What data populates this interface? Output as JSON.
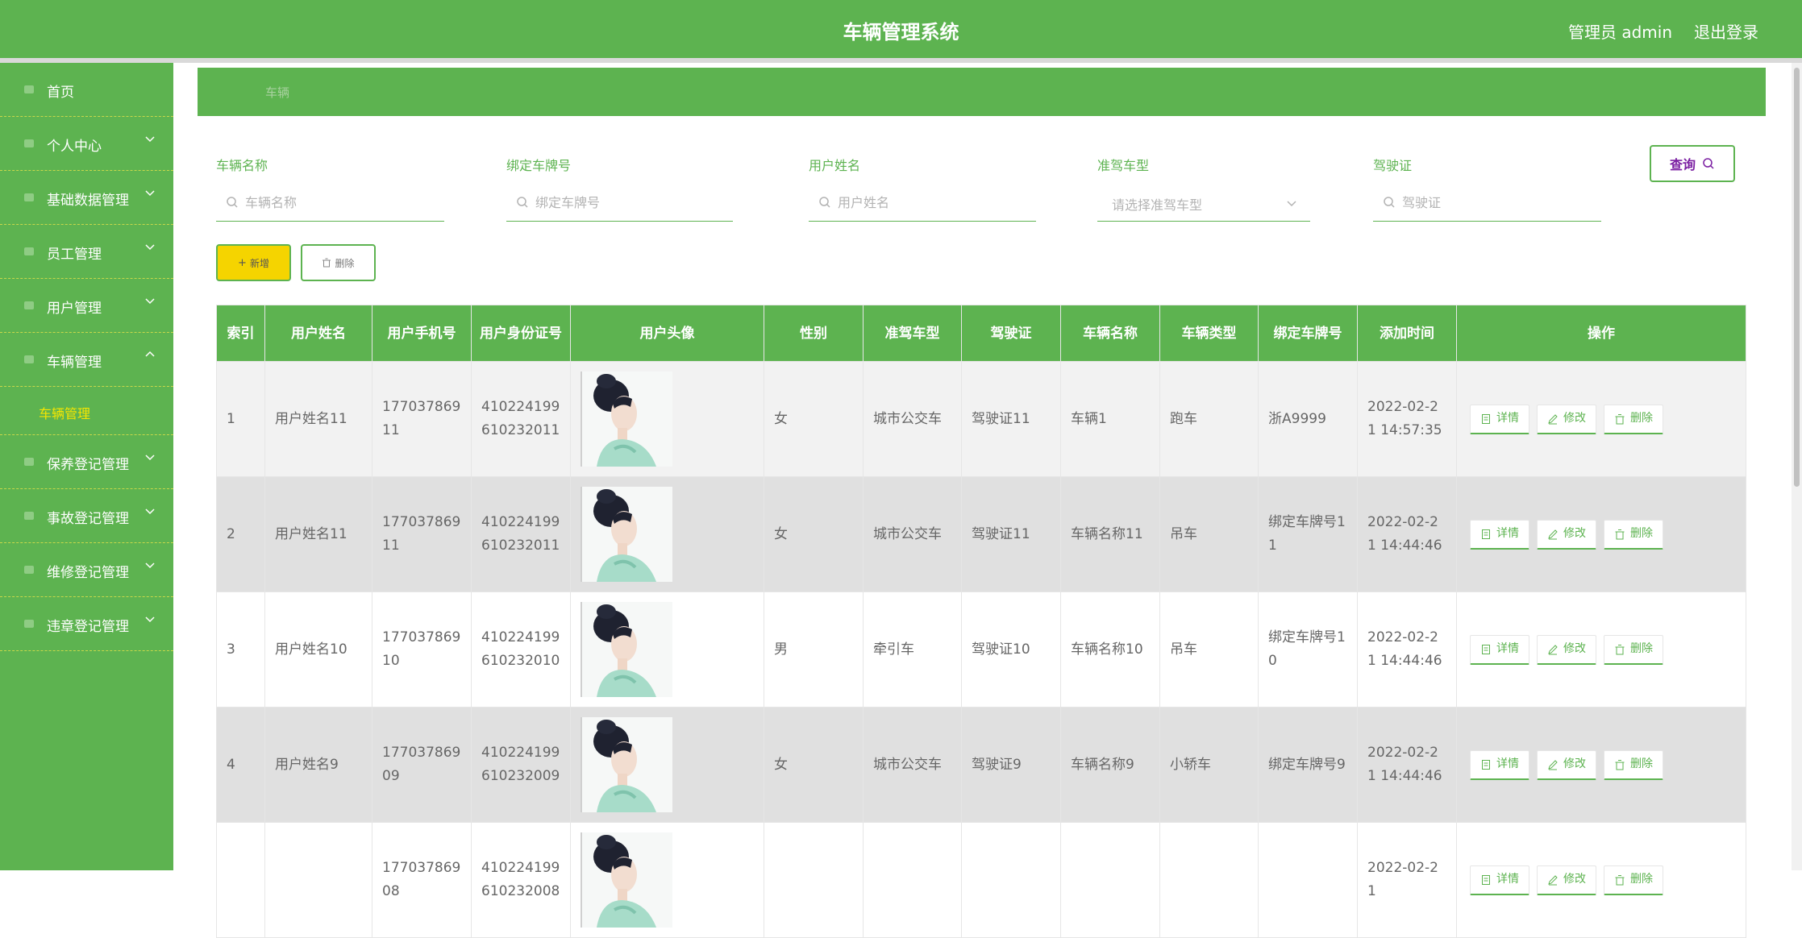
{
  "header": {
    "title": "车辆管理系统",
    "user": "管理员 admin",
    "logout": "退出登录"
  },
  "sidebar": {
    "items": [
      {
        "label": "首页",
        "icon": "home-icon",
        "has_arrow": false
      },
      {
        "label": "个人中心",
        "icon": "user-icon",
        "has_arrow": true
      },
      {
        "label": "基础数据管理",
        "icon": "data-icon",
        "has_arrow": true
      },
      {
        "label": "员工管理",
        "icon": "staff-icon",
        "has_arrow": true
      },
      {
        "label": "用户管理",
        "icon": "users-icon",
        "has_arrow": true
      },
      {
        "label": "车辆管理",
        "icon": "car-icon",
        "has_arrow": true,
        "expanded": true
      },
      {
        "label": "保养登记管理",
        "icon": "maintenance-icon",
        "has_arrow": true
      },
      {
        "label": "事故登记管理",
        "icon": "accident-icon",
        "has_arrow": true
      },
      {
        "label": "维修登记管理",
        "icon": "repair-icon",
        "has_arrow": true
      },
      {
        "label": "违章登记管理",
        "icon": "violation-icon",
        "has_arrow": true
      }
    ],
    "submenu": {
      "label": "车辆管理"
    }
  },
  "breadcrumb": {
    "current": "车辆"
  },
  "search": {
    "fields": [
      {
        "label": "车辆名称",
        "placeholder": "车辆名称"
      },
      {
        "label": "绑定车牌号",
        "placeholder": "绑定车牌号"
      },
      {
        "label": "用户姓名",
        "placeholder": "用户姓名"
      },
      {
        "label": "准驾车型",
        "placeholder": "请选择准驾车型"
      },
      {
        "label": "驾驶证",
        "placeholder": "驾驶证"
      }
    ],
    "query_label": "查询"
  },
  "actions": {
    "add_label": "新增",
    "delete_label": "删除"
  },
  "table": {
    "headers": [
      "索引",
      "用户姓名",
      "用户手机号",
      "用户身份证号",
      "用户头像",
      "性别",
      "准驾车型",
      "驾驶证",
      "车辆名称",
      "车辆类型",
      "绑定车牌号",
      "添加时间",
      "操作"
    ],
    "rows": [
      {
        "index": "1",
        "name": "用户姓名11",
        "phone": "17703786911",
        "id_card": "410224199610232011",
        "gender": "女",
        "license_type": "城市公交车",
        "license": "驾驶证11",
        "vehicle_name": "车辆1",
        "vehicle_type": "跑车",
        "plate": "浙A9999",
        "time": "2022-02-21 14:57:35"
      },
      {
        "index": "2",
        "name": "用户姓名11",
        "phone": "17703786911",
        "id_card": "410224199610232011",
        "gender": "女",
        "license_type": "城市公交车",
        "license": "驾驶证11",
        "vehicle_name": "车辆名称11",
        "vehicle_type": "吊车",
        "plate": "绑定车牌号11",
        "time": "2022-02-21 14:44:46"
      },
      {
        "index": "3",
        "name": "用户姓名10",
        "phone": "17703786910",
        "id_card": "410224199610232010",
        "gender": "男",
        "license_type": "牵引车",
        "license": "驾驶证10",
        "vehicle_name": "车辆名称10",
        "vehicle_type": "吊车",
        "plate": "绑定车牌号10",
        "time": "2022-02-21 14:44:46"
      },
      {
        "index": "4",
        "name": "用户姓名9",
        "phone": "17703786909",
        "id_card": "410224199610232009",
        "gender": "女",
        "license_type": "城市公交车",
        "license": "驾驶证9",
        "vehicle_name": "车辆名称9",
        "vehicle_type": "小轿车",
        "plate": "绑定车牌号9",
        "time": "2022-02-21 14:44:46"
      },
      {
        "index": "",
        "name": "",
        "phone": "17703786908",
        "id_card": "410224199610232008",
        "gender": "",
        "license_type": "",
        "license": "",
        "vehicle_name": "",
        "vehicle_type": "",
        "plate": "",
        "time": "2022-02-21"
      }
    ],
    "row_actions": {
      "detail": "详情",
      "edit": "修改",
      "delete": "删除"
    }
  },
  "colors": {
    "primary": "#5db350",
    "accent_yellow": "#f5d400",
    "submenu_active": "#f5e600"
  }
}
